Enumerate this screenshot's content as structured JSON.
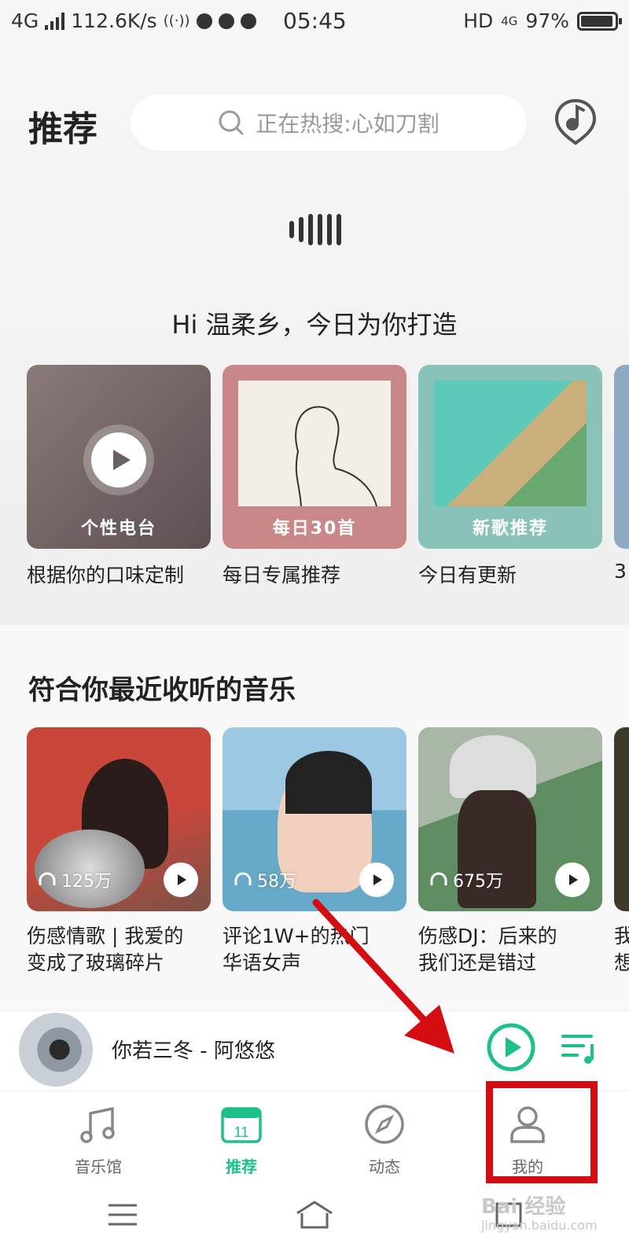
{
  "status_bar": {
    "network": "4G",
    "speed": "112.6K/s",
    "time": "05:45",
    "hd": "HD",
    "network_right": "4G",
    "battery": "97%"
  },
  "header": {
    "title": "推荐",
    "search_placeholder": "正在热搜:心如刀割"
  },
  "greeting": "Hi 温柔乡，今日为你打造",
  "daily_cards": [
    {
      "label": "个性电台",
      "caption": "根据你的口味定制",
      "color": "#7d6e6e"
    },
    {
      "label": "每日30首",
      "caption": "每日专属推荐",
      "color": "#c98787"
    },
    {
      "label": "新歌推荐",
      "caption": "今日有更新",
      "color": "#89c2b9"
    },
    {
      "caption": "3"
    }
  ],
  "recent_section": {
    "title": "符合你最近收听的音乐",
    "playlists": [
      {
        "count": "125万",
        "title_line1": "伤感情歌 | 我爱的",
        "title_line2": "变成了玻璃碎片"
      },
      {
        "count": "58万",
        "title_line1": "评论1W+的热门",
        "title_line2": "华语女声"
      },
      {
        "count": "675万",
        "title_line1": "伤感DJ：后来的",
        "title_line2": "我们还是错过"
      },
      {
        "title_line1": "我",
        "title_line2": "想"
      }
    ]
  },
  "now_playing": {
    "title": "你若三冬 - 阿悠悠"
  },
  "tabs": {
    "music_hall": "音乐馆",
    "recommend": "推荐",
    "calendar_day": "11",
    "feed": "动态",
    "mine": "我的"
  },
  "watermark": {
    "line1": "Bai 经验",
    "line2": "jingyan.baidu.com"
  },
  "colors": {
    "accent": "#1ec08a",
    "highlight_box": "#d40d12"
  }
}
